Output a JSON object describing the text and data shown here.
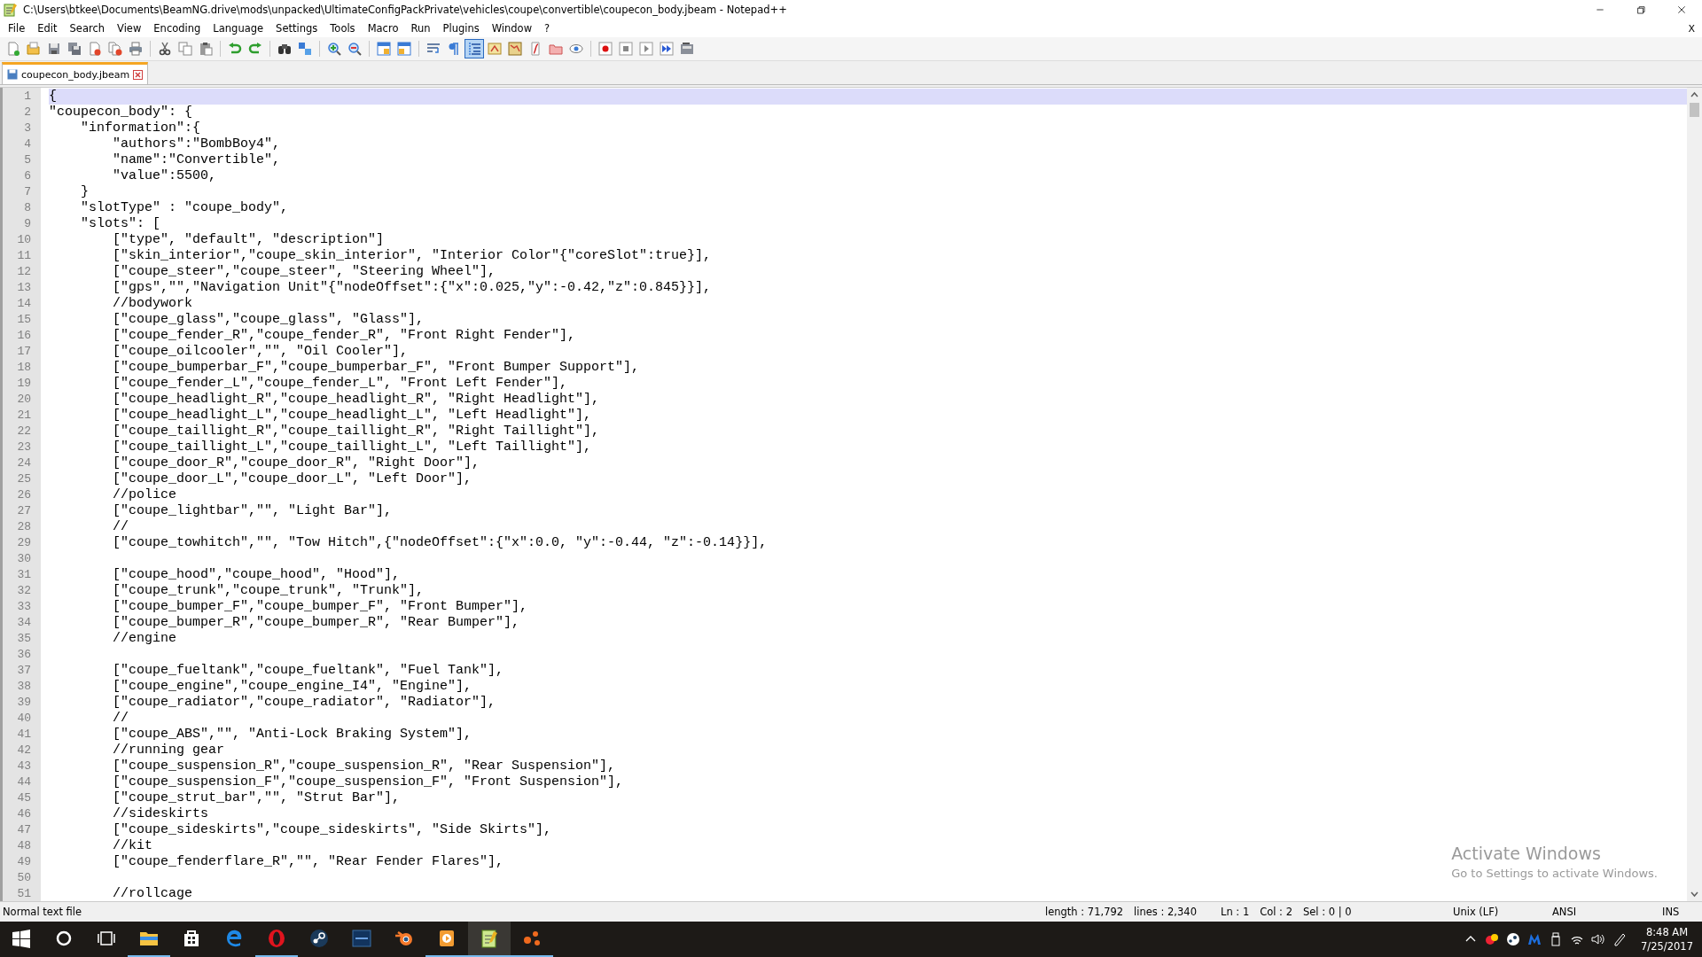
{
  "window": {
    "title": "C:\\Users\\btkee\\Documents\\BeamNG.drive\\mods\\unpacked\\UltimateConfigPackPrivate\\vehicles\\coupe\\convertible\\coupecon_body.jbeam - Notepad++"
  },
  "menu": {
    "items": [
      "File",
      "Edit",
      "Search",
      "View",
      "Encoding",
      "Language",
      "Settings",
      "Tools",
      "Macro",
      "Run",
      "Plugins",
      "Window",
      "?"
    ],
    "close_document": "X"
  },
  "toolbar": [
    {
      "kind": "new",
      "pressed": false
    },
    {
      "kind": "open",
      "pressed": false
    },
    {
      "kind": "save",
      "pressed": false
    },
    {
      "kind": "saveall",
      "pressed": false
    },
    {
      "kind": "close",
      "pressed": false
    },
    {
      "kind": "closeall",
      "pressed": false
    },
    {
      "kind": "print",
      "pressed": false
    },
    {
      "kind": "sep"
    },
    {
      "kind": "cut",
      "pressed": false
    },
    {
      "kind": "copy",
      "pressed": false
    },
    {
      "kind": "paste",
      "pressed": false
    },
    {
      "kind": "sep"
    },
    {
      "kind": "undo",
      "pressed": false
    },
    {
      "kind": "redo",
      "pressed": false
    },
    {
      "kind": "sep"
    },
    {
      "kind": "find",
      "pressed": false
    },
    {
      "kind": "replace",
      "pressed": false
    },
    {
      "kind": "sep"
    },
    {
      "kind": "zoomin",
      "pressed": false
    },
    {
      "kind": "zoomout",
      "pressed": false
    },
    {
      "kind": "sep"
    },
    {
      "kind": "syncv",
      "pressed": false
    },
    {
      "kind": "synch",
      "pressed": false
    },
    {
      "kind": "sep"
    },
    {
      "kind": "wrap",
      "pressed": false
    },
    {
      "kind": "pilcrow",
      "pressed": false
    },
    {
      "kind": "indent",
      "pressed": true
    },
    {
      "kind": "udl",
      "pressed": false
    },
    {
      "kind": "map",
      "pressed": false
    },
    {
      "kind": "func",
      "pressed": false
    },
    {
      "kind": "folder",
      "pressed": false
    },
    {
      "kind": "eye",
      "pressed": false
    },
    {
      "kind": "sep"
    },
    {
      "kind": "record",
      "pressed": false
    },
    {
      "kind": "stop",
      "pressed": false
    },
    {
      "kind": "play",
      "pressed": false
    },
    {
      "kind": "playmulti",
      "pressed": false
    },
    {
      "kind": "savemacro",
      "pressed": false
    }
  ],
  "tabs": [
    {
      "label": "coupecon_body.jbeam",
      "selected": true
    }
  ],
  "editor": {
    "lines": [
      {
        "number": "1",
        "text": "{",
        "current": true
      },
      {
        "number": "2",
        "text": "\"coupecon_body\": {",
        "current": false
      },
      {
        "number": "3",
        "text": "    \"information\":{",
        "current": false
      },
      {
        "number": "4",
        "text": "        \"authors\":\"BombBoy4\",",
        "current": false
      },
      {
        "number": "5",
        "text": "        \"name\":\"Convertible\",",
        "current": false
      },
      {
        "number": "6",
        "text": "        \"value\":5500,",
        "current": false
      },
      {
        "number": "7",
        "text": "    }",
        "current": false
      },
      {
        "number": "8",
        "text": "    \"slotType\" : \"coupe_body\",",
        "current": false
      },
      {
        "number": "9",
        "text": "    \"slots\": [",
        "current": false
      },
      {
        "number": "10",
        "text": "        [\"type\", \"default\", \"description\"]",
        "current": false
      },
      {
        "number": "11",
        "text": "        [\"skin_interior\",\"coupe_skin_interior\", \"Interior Color\"{\"coreSlot\":true}],",
        "current": false
      },
      {
        "number": "12",
        "text": "        [\"coupe_steer\",\"coupe_steer\", \"Steering Wheel\"],",
        "current": false
      },
      {
        "number": "13",
        "text": "        [\"gps\",\"\",\"Navigation Unit\"{\"nodeOffset\":{\"x\":0.025,\"y\":-0.42,\"z\":0.845}}],",
        "current": false
      },
      {
        "number": "14",
        "text": "        //bodywork",
        "current": false
      },
      {
        "number": "15",
        "text": "        [\"coupe_glass\",\"coupe_glass\", \"Glass\"],",
        "current": false
      },
      {
        "number": "16",
        "text": "        [\"coupe_fender_R\",\"coupe_fender_R\", \"Front Right Fender\"],",
        "current": false
      },
      {
        "number": "17",
        "text": "        [\"coupe_oilcooler\",\"\", \"Oil Cooler\"],",
        "current": false
      },
      {
        "number": "18",
        "text": "        [\"coupe_bumperbar_F\",\"coupe_bumperbar_F\", \"Front Bumper Support\"],",
        "current": false
      },
      {
        "number": "19",
        "text": "        [\"coupe_fender_L\",\"coupe_fender_L\", \"Front Left Fender\"],",
        "current": false
      },
      {
        "number": "20",
        "text": "        [\"coupe_headlight_R\",\"coupe_headlight_R\", \"Right Headlight\"],",
        "current": false
      },
      {
        "number": "21",
        "text": "        [\"coupe_headlight_L\",\"coupe_headlight_L\", \"Left Headlight\"],",
        "current": false
      },
      {
        "number": "22",
        "text": "        [\"coupe_taillight_R\",\"coupe_taillight_R\", \"Right Taillight\"],",
        "current": false
      },
      {
        "number": "23",
        "text": "        [\"coupe_taillight_L\",\"coupe_taillight_L\", \"Left Taillight\"],",
        "current": false
      },
      {
        "number": "24",
        "text": "        [\"coupe_door_R\",\"coupe_door_R\", \"Right Door\"],",
        "current": false
      },
      {
        "number": "25",
        "text": "        [\"coupe_door_L\",\"coupe_door_L\", \"Left Door\"],",
        "current": false
      },
      {
        "number": "26",
        "text": "        //police",
        "current": false
      },
      {
        "number": "27",
        "text": "        [\"coupe_lightbar\",\"\", \"Light Bar\"],",
        "current": false
      },
      {
        "number": "28",
        "text": "        //",
        "current": false
      },
      {
        "number": "29",
        "text": "        [\"coupe_towhitch\",\"\", \"Tow Hitch\",{\"nodeOffset\":{\"x\":0.0, \"y\":-0.44, \"z\":-0.14}}],",
        "current": false
      },
      {
        "number": "30",
        "current": false
      },
      {
        "number": "31",
        "text": "        [\"coupe_hood\",\"coupe_hood\", \"Hood\"],",
        "current": false
      },
      {
        "number": "32",
        "text": "        [\"coupe_trunk\",\"coupe_trunk\", \"Trunk\"],",
        "current": false
      },
      {
        "number": "33",
        "text": "        [\"coupe_bumper_F\",\"coupe_bumper_F\", \"Front Bumper\"],",
        "current": false
      },
      {
        "number": "34",
        "text": "        [\"coupe_bumper_R\",\"coupe_bumper_R\", \"Rear Bumper\"],",
        "current": false
      },
      {
        "number": "35",
        "text": "        //engine",
        "current": false
      },
      {
        "number": "36",
        "current": false
      },
      {
        "number": "37",
        "text": "        [\"coupe_fueltank\",\"coupe_fueltank\", \"Fuel Tank\"],",
        "current": false
      },
      {
        "number": "38",
        "text": "        [\"coupe_engine\",\"coupe_engine_I4\", \"Engine\"],",
        "current": false
      },
      {
        "number": "39",
        "text": "        [\"coupe_radiator\",\"coupe_radiator\", \"Radiator\"],",
        "current": false
      },
      {
        "number": "40",
        "text": "        //",
        "current": false
      },
      {
        "number": "41",
        "text": "        [\"coupe_ABS\",\"\", \"Anti-Lock Braking System\"],",
        "current": false
      },
      {
        "number": "42",
        "text": "        //running gear",
        "current": false
      },
      {
        "number": "43",
        "text": "        [\"coupe_suspension_R\",\"coupe_suspension_R\", \"Rear Suspension\"],",
        "current": false
      },
      {
        "number": "44",
        "text": "        [\"coupe_suspension_F\",\"coupe_suspension_F\", \"Front Suspension\"],",
        "current": false
      },
      {
        "number": "45",
        "text": "        [\"coupe_strut_bar\",\"\", \"Strut Bar\"],",
        "current": false
      },
      {
        "number": "46",
        "text": "        //sideskirts",
        "current": false
      },
      {
        "number": "47",
        "text": "        [\"coupe_sideskirts\",\"coupe_sideskirts\", \"Side Skirts\"],",
        "current": false
      },
      {
        "number": "48",
        "text": "        //kit",
        "current": false
      },
      {
        "number": "49",
        "text": "        [\"coupe_fenderflare_R\",\"\", \"Rear Fender Flares\"],",
        "current": false
      },
      {
        "number": "50",
        "current": false
      },
      {
        "number": "51",
        "text": "        //rollcage",
        "current": false
      }
    ],
    "watermark": {
      "title": "Activate Windows",
      "subtitle": "Go to Settings to activate Windows."
    }
  },
  "status_bar": {
    "file_type": "Normal text file",
    "length": "length : 71,792",
    "lines": "lines : 2,340",
    "ln": "Ln : 1",
    "col": "Col : 2",
    "sel": "Sel : 0 | 0",
    "eol": "Unix (LF)",
    "encoding": "ANSI",
    "mode": "INS"
  },
  "taskbar": {
    "apps": [
      {
        "kind": "start",
        "running": false,
        "active": false
      },
      {
        "kind": "cortana",
        "running": false,
        "active": false
      },
      {
        "kind": "taskview",
        "running": false,
        "active": false
      },
      {
        "kind": "explorer",
        "running": true,
        "active": false
      },
      {
        "kind": "store",
        "running": false,
        "active": false
      },
      {
        "kind": "edge",
        "running": false,
        "active": false
      },
      {
        "kind": "opera",
        "running": true,
        "active": false
      },
      {
        "kind": "steam",
        "running": false,
        "active": false
      },
      {
        "kind": "launcher",
        "running": false,
        "active": false
      },
      {
        "kind": "blender",
        "running": false,
        "active": false
      },
      {
        "kind": "media",
        "running": true,
        "active": false
      },
      {
        "kind": "notepad",
        "running": true,
        "active": true
      },
      {
        "kind": "nodes",
        "running": true,
        "active": false
      }
    ],
    "time": "8:48 AM",
    "date": "7/25/2017"
  }
}
